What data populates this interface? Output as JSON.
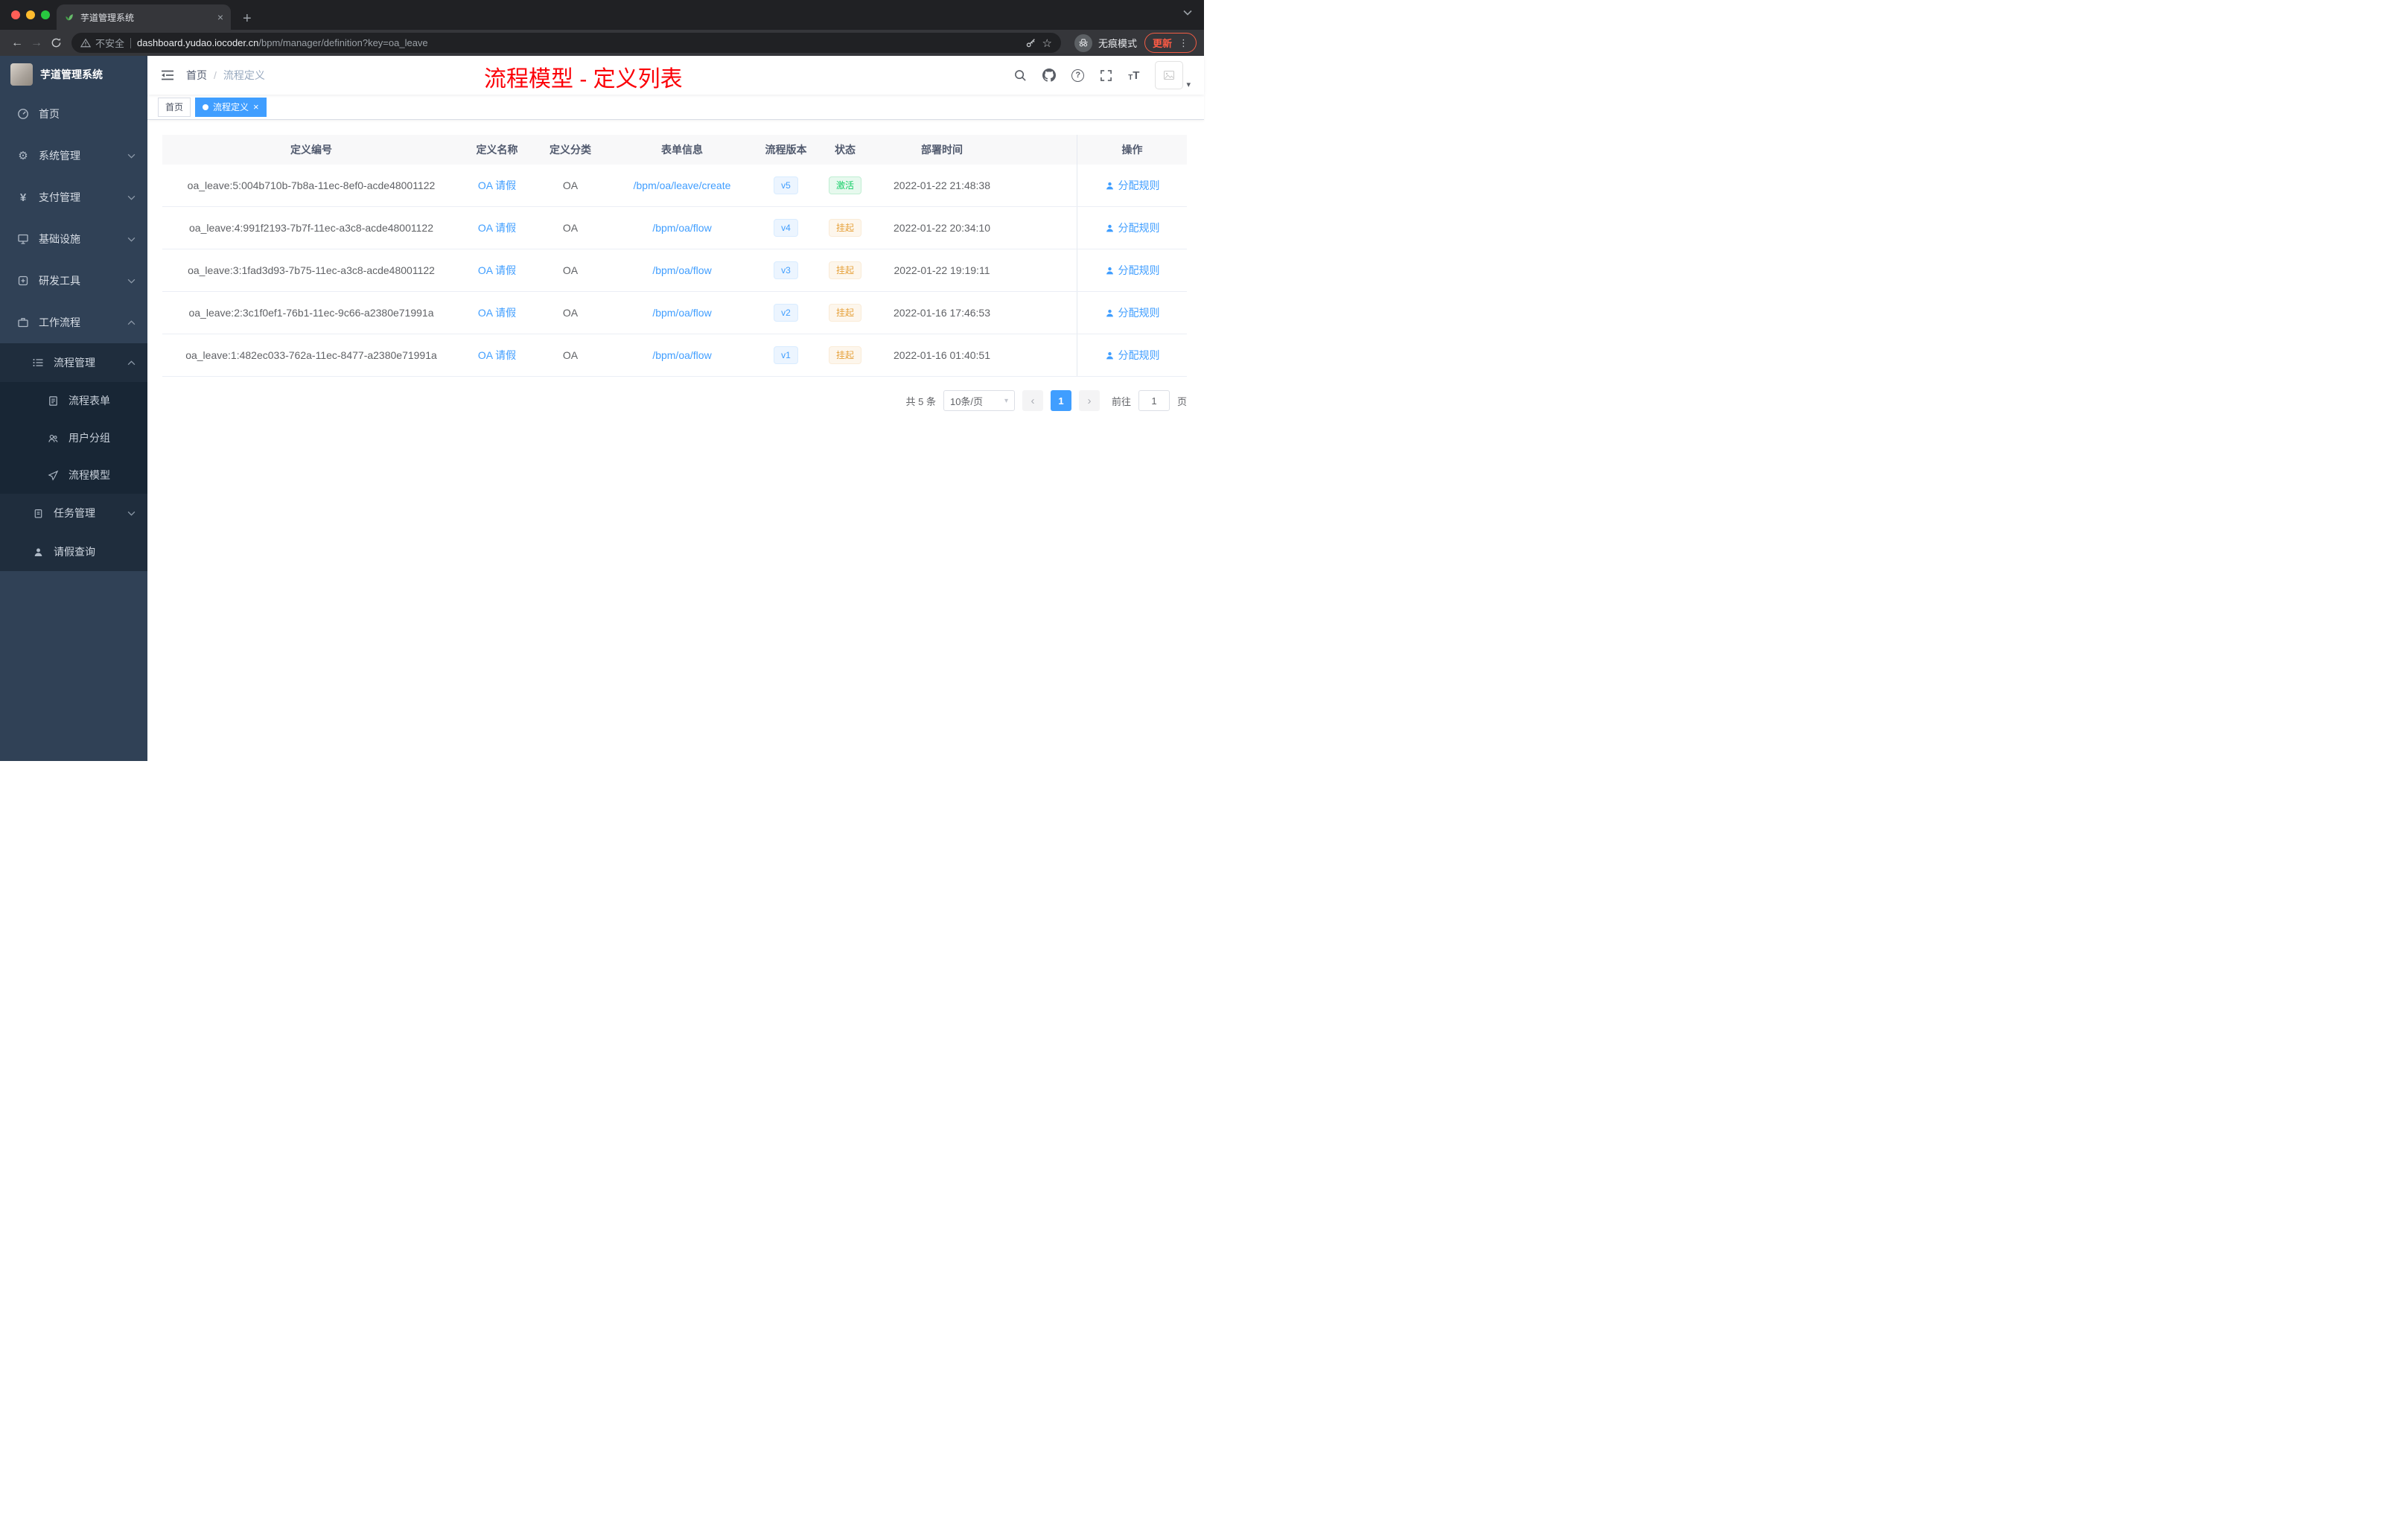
{
  "browser": {
    "tab_title": "芋道管理系统",
    "security_label": "不安全",
    "url_host": "dashboard.yudao.iocoder.cn",
    "url_path": "/bpm/manager/definition?key=oa_leave",
    "incognito_label": "无痕模式",
    "update_label": "更新"
  },
  "sidebar": {
    "logo_title": "芋道管理系统",
    "items": [
      {
        "label": "首页"
      },
      {
        "label": "系统管理"
      },
      {
        "label": "支付管理"
      },
      {
        "label": "基础设施"
      },
      {
        "label": "研发工具"
      },
      {
        "label": "工作流程",
        "expanded": true,
        "children": [
          {
            "label": "流程管理",
            "expanded": true,
            "children": [
              {
                "label": "流程表单"
              },
              {
                "label": "用户分组"
              },
              {
                "label": "流程模型"
              }
            ]
          },
          {
            "label": "任务管理"
          },
          {
            "label": "请假查询"
          }
        ]
      }
    ]
  },
  "header": {
    "breadcrumb": [
      {
        "label": "首页"
      },
      {
        "label": "流程定义"
      }
    ],
    "overlay_title": "流程模型 - 定义列表"
  },
  "tags_view": {
    "tags": [
      {
        "label": "首页",
        "active": false
      },
      {
        "label": "流程定义",
        "active": true
      }
    ]
  },
  "table": {
    "columns": [
      "定义编号",
      "定义名称",
      "定义分类",
      "表单信息",
      "流程版本",
      "状态",
      "部署时间",
      "操作"
    ],
    "rows": [
      {
        "id": "oa_leave:5:004b710b-7b8a-11ec-8ef0-acde48001122",
        "name": "OA 请假",
        "category": "OA",
        "form": "/bpm/oa/leave/create",
        "version": "v5",
        "status": "激活",
        "time": "2022-01-22 21:48:38",
        "action": "分配规则"
      },
      {
        "id": "oa_leave:4:991f2193-7b7f-11ec-a3c8-acde48001122",
        "name": "OA 请假",
        "category": "OA",
        "form": "/bpm/oa/flow",
        "version": "v4",
        "status": "挂起",
        "time": "2022-01-22 20:34:10",
        "action": "分配规则"
      },
      {
        "id": "oa_leave:3:1fad3d93-7b75-11ec-a3c8-acde48001122",
        "name": "OA 请假",
        "category": "OA",
        "form": "/bpm/oa/flow",
        "version": "v3",
        "status": "挂起",
        "time": "2022-01-22 19:19:11",
        "action": "分配规则"
      },
      {
        "id": "oa_leave:2:3c1f0ef1-76b1-11ec-9c66-a2380e71991a",
        "name": "OA 请假",
        "category": "OA",
        "form": "/bpm/oa/flow",
        "version": "v2",
        "status": "挂起",
        "time": "2022-01-16 17:46:53",
        "action": "分配规则"
      },
      {
        "id": "oa_leave:1:482ec033-762a-11ec-8477-a2380e71991a",
        "name": "OA 请假",
        "category": "OA",
        "form": "/bpm/oa/flow",
        "version": "v1",
        "status": "挂起",
        "time": "2022-01-16 01:40:51",
        "action": "分配规则"
      }
    ]
  },
  "pagination": {
    "total_label": "共 5 条",
    "page_size_label": "10条/页",
    "current_page": "1",
    "goto_label": "前往",
    "goto_value": "1",
    "unit_label": "页"
  },
  "colors": {
    "accent": "#409eff",
    "success": "#13ce66",
    "success_bg": "#e7f9ee",
    "warning": "#e6a23c",
    "warning_bg": "#fdf6ec",
    "sidebar_bg": "#304156",
    "submenu_bg": "#1f2d3d",
    "submenu2_bg": "#182635",
    "overlay_red": "#fb0007",
    "chrome_dark": "#202124",
    "chrome_toolbar": "#35363a"
  }
}
